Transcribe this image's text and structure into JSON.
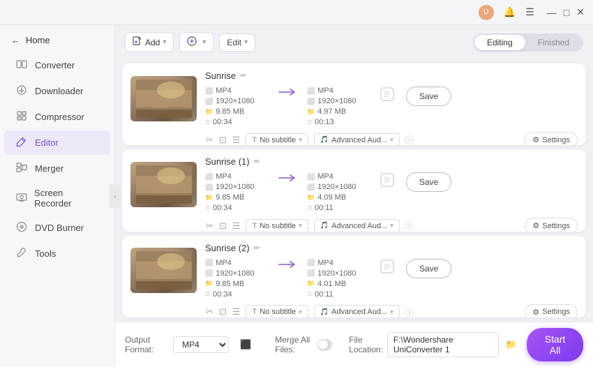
{
  "titlebar": {
    "min_label": "—",
    "max_label": "□",
    "close_label": "✕"
  },
  "sidebar": {
    "home_label": "Home",
    "items": [
      {
        "id": "converter",
        "label": "Converter",
        "icon": "⬜",
        "active": false
      },
      {
        "id": "downloader",
        "label": "Downloader",
        "icon": "⬇",
        "active": false
      },
      {
        "id": "compressor",
        "label": "Compressor",
        "icon": "🗜",
        "active": false
      },
      {
        "id": "editor",
        "label": "Editor",
        "icon": "✏",
        "active": true
      },
      {
        "id": "merger",
        "label": "Merger",
        "icon": "⊞",
        "active": false
      },
      {
        "id": "screen-recorder",
        "label": "Screen Recorder",
        "icon": "⬛",
        "active": false
      },
      {
        "id": "dvd-burner",
        "label": "DVD Burner",
        "icon": "💿",
        "active": false
      },
      {
        "id": "tools",
        "label": "Tools",
        "icon": "🔧",
        "active": false
      }
    ]
  },
  "toolbar": {
    "add_btn_label": "+ Add",
    "add_option_label": "▾",
    "add_btn2_label": "⊕",
    "add_btn2_suffix": "▾",
    "edit_label": "Edit",
    "edit_suffix": "▾",
    "tab_editing": "Editing",
    "tab_finished": "Finished"
  },
  "files": [
    {
      "id": "file1",
      "name": "Sunrise",
      "src_format": "MP4",
      "src_resolution": "1920×1080",
      "src_size": "9.85 MB",
      "src_duration": "00:34",
      "dst_format": "MP4",
      "dst_resolution": "1920×1080",
      "dst_size": "4.97 MB",
      "dst_duration": "00:13",
      "subtitle": "No subtitle",
      "audio": "Advanced Aud...",
      "save_label": "Save"
    },
    {
      "id": "file2",
      "name": "Sunrise (1)",
      "src_format": "MP4",
      "src_resolution": "1920×1080",
      "src_size": "9.85 MB",
      "src_duration": "00:34",
      "dst_format": "MP4",
      "dst_resolution": "1920×1080",
      "dst_size": "4.09 MB",
      "dst_duration": "00:11",
      "subtitle": "No subtitle",
      "audio": "Advanced Aud...",
      "save_label": "Save"
    },
    {
      "id": "file3",
      "name": "Sunrise (2)",
      "src_format": "MP4",
      "src_resolution": "1920×1080",
      "src_size": "9.85 MB",
      "src_duration": "00:34",
      "dst_format": "MP4",
      "dst_resolution": "1920×1080",
      "dst_size": "4.01 MB",
      "dst_duration": "00:11",
      "subtitle": "No subtitle",
      "audio": "Advanced Aud...",
      "save_label": "Save"
    }
  ],
  "bottom": {
    "output_format_label": "Output Format:",
    "output_format_value": "MP4",
    "merge_label": "Merge All Files:",
    "file_location_label": "File Location:",
    "file_location_value": "F:\\Wondershare UniConverter 1",
    "start_all_label": "Start All"
  },
  "icons": {
    "settings": "⚙",
    "gear": "⚙",
    "info": "ⓘ",
    "scissors": "✂",
    "crop": "⊡",
    "adjust": "☰",
    "subtitle": "T",
    "audio": "🎵",
    "arrow": "→",
    "edit": "✏",
    "folder": "📁",
    "export": "⬛"
  }
}
